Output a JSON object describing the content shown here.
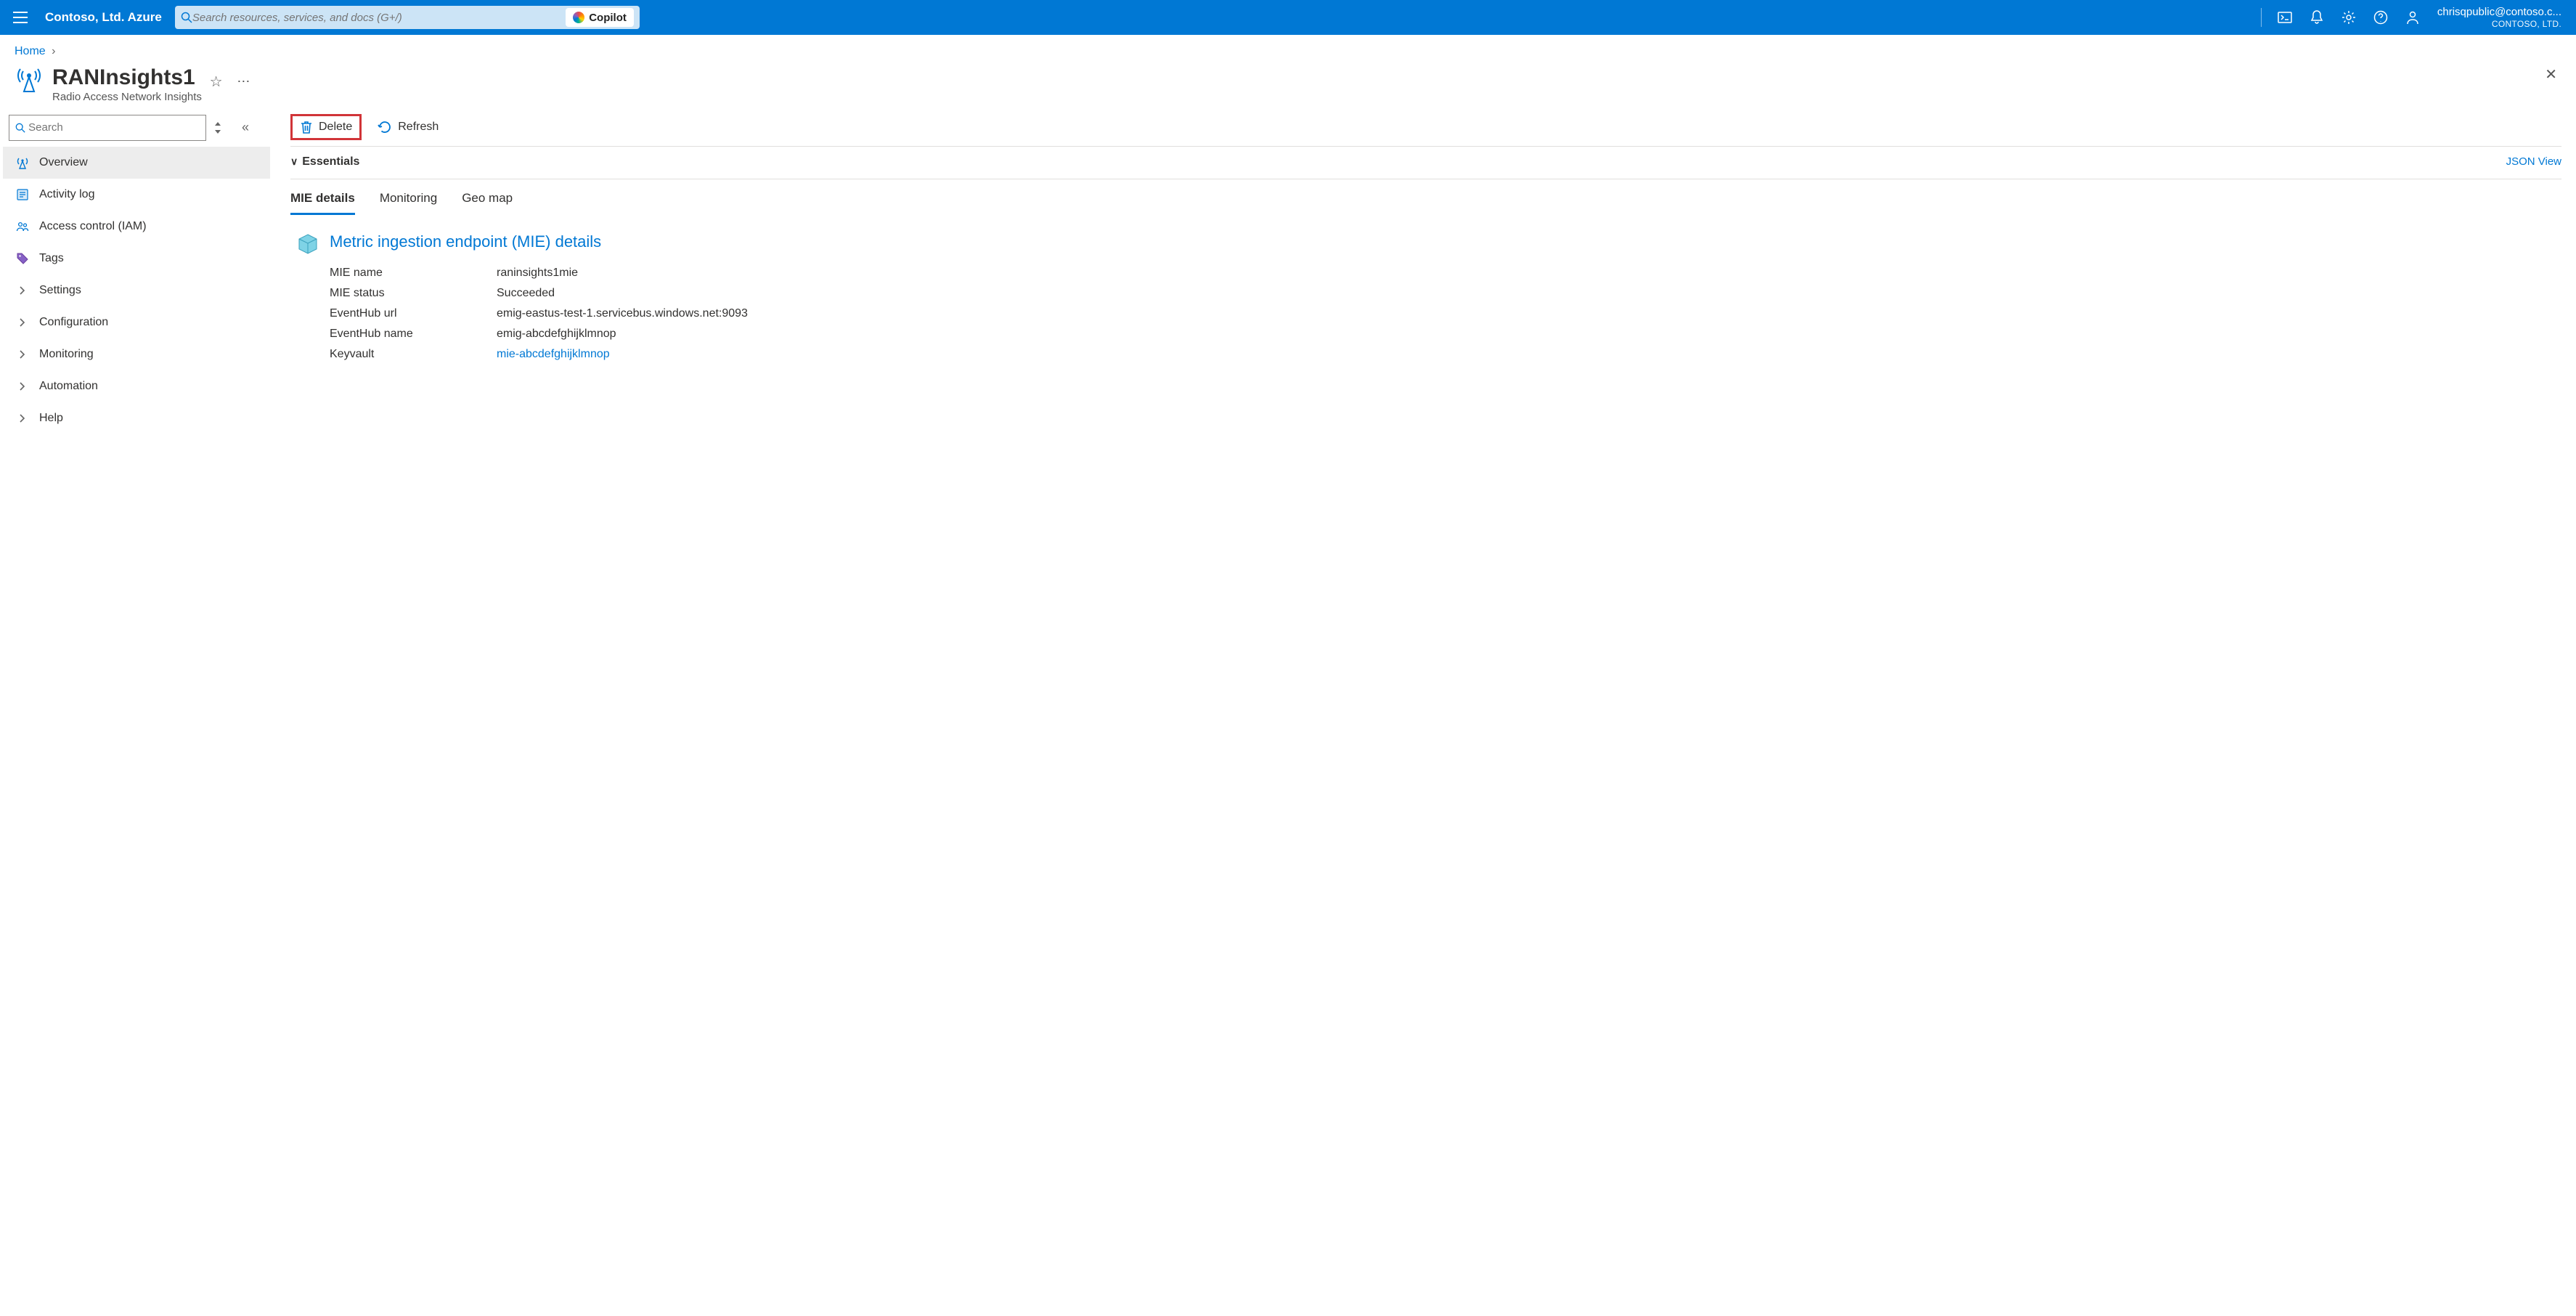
{
  "header": {
    "brand": "Contoso, Ltd. Azure",
    "search_placeholder": "Search resources, services, and docs (G+/)",
    "copilot": "Copilot",
    "account_email": "chrisqpublic@contoso.c...",
    "account_tenant": "CONTOSO, LTD."
  },
  "breadcrumb": {
    "home": "Home"
  },
  "resource": {
    "title": "RANInsights1",
    "subtitle": "Radio Access Network Insights"
  },
  "sidebar": {
    "search_placeholder": "Search",
    "items": [
      {
        "label": "Overview",
        "icon": "antenna",
        "selected": true
      },
      {
        "label": "Activity log",
        "icon": "log"
      },
      {
        "label": "Access control (IAM)",
        "icon": "people"
      },
      {
        "label": "Tags",
        "icon": "tag"
      },
      {
        "label": "Settings",
        "icon": "chev"
      },
      {
        "label": "Configuration",
        "icon": "chev"
      },
      {
        "label": "Monitoring",
        "icon": "chev"
      },
      {
        "label": "Automation",
        "icon": "chev"
      },
      {
        "label": "Help",
        "icon": "chev"
      }
    ]
  },
  "toolbar": {
    "delete": "Delete",
    "refresh": "Refresh"
  },
  "essentials": {
    "label": "Essentials",
    "json_view": "JSON View"
  },
  "tabs": [
    {
      "label": "MIE details",
      "active": true
    },
    {
      "label": "Monitoring"
    },
    {
      "label": "Geo map"
    }
  ],
  "mie": {
    "heading": "Metric ingestion endpoint (MIE) details",
    "rows": [
      {
        "k": "MIE name",
        "v": "raninsights1mie"
      },
      {
        "k": "MIE status",
        "v": "Succeeded"
      },
      {
        "k": "EventHub url",
        "v": "emig-eastus-test-1.servicebus.windows.net:9093"
      },
      {
        "k": "EventHub name",
        "v": "emig-abcdefghijklmnop"
      },
      {
        "k": "Keyvault",
        "v": "mie-abcdefghijklmnop",
        "link": true
      }
    ]
  }
}
